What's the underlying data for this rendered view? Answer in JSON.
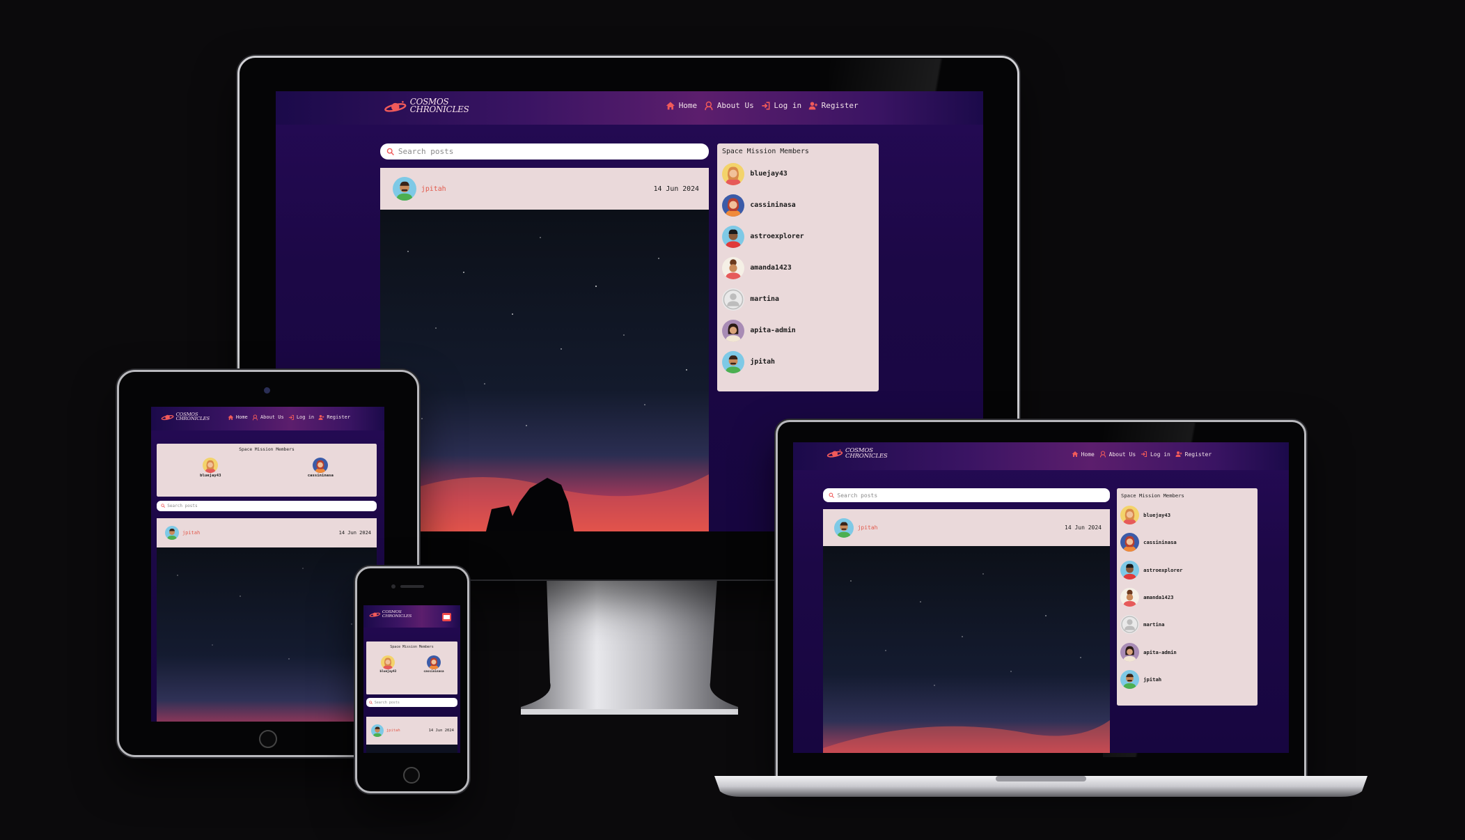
{
  "app": {
    "logo_line1": "COSMOS",
    "logo_line2": "CHRONICLES"
  },
  "nav": {
    "home": "Home",
    "about": "About Us",
    "login": "Log in",
    "register": "Register"
  },
  "search": {
    "placeholder": "Search posts"
  },
  "post": {
    "author": "jpitah",
    "date": "14 Jun 2024"
  },
  "members": {
    "title": "Space Mission Members",
    "list": [
      {
        "name": "bluejay43"
      },
      {
        "name": "cassininasa"
      },
      {
        "name": "astroexplorer"
      },
      {
        "name": "amanda1423"
      },
      {
        "name": "martina"
      },
      {
        "name": "apita-admin"
      },
      {
        "name": "jpitah"
      }
    ]
  },
  "colors": {
    "accent": "#f05a5a",
    "author_link": "#e25a4c",
    "card_bg": "#ead9da",
    "page_bg_dark": "#170640",
    "nav_mid": "#5c1e6d"
  },
  "icons": {
    "home": "home-icon",
    "about": "astronaut-icon",
    "login": "login-icon",
    "register": "add-user-icon",
    "search": "search-icon",
    "menu": "hamburger-menu-icon"
  }
}
